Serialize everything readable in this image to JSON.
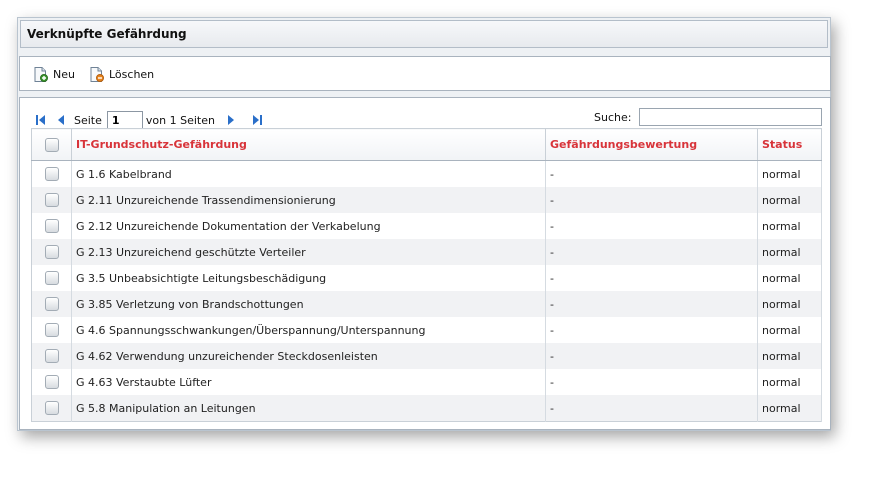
{
  "window": {
    "title": "Verknüpfte Gefährdung"
  },
  "toolbar": {
    "new_label": "Neu",
    "new_icon": "document-add-icon",
    "delete_label": "Löschen",
    "delete_icon": "document-delete-icon"
  },
  "pager": {
    "page_label": "Seite",
    "current_page": "1",
    "of_pages": "von 1 Seiten",
    "icons": [
      "first-page-icon",
      "previous-page-icon",
      "next-page-icon",
      "last-page-icon"
    ]
  },
  "search": {
    "label": "Suche:",
    "value": ""
  },
  "colors": {
    "header_text": "#d8343a",
    "accent_blue": "#2a6fc9"
  },
  "table": {
    "columns": [
      "IT-Grundschutz-Gefährdung",
      "Gefährdungsbewertung",
      "Status"
    ],
    "rows": [
      {
        "name": "G 1.6 Kabelbrand",
        "rating": "-",
        "status": "normal"
      },
      {
        "name": "G 2.11 Unzureichende Trassendimensionierung",
        "rating": "-",
        "status": "normal"
      },
      {
        "name": "G 2.12 Unzureichende Dokumentation der Verkabelung",
        "rating": "-",
        "status": "normal"
      },
      {
        "name": "G 2.13 Unzureichend geschützte Verteiler",
        "rating": "-",
        "status": "normal"
      },
      {
        "name": "G 3.5 Unbeabsichtigte Leitungsbeschädigung",
        "rating": "-",
        "status": "normal"
      },
      {
        "name": "G 3.85 Verletzung von Brandschottungen",
        "rating": "-",
        "status": "normal"
      },
      {
        "name": "G 4.6 Spannungsschwankungen/Überspannung/Unterspannung",
        "rating": "-",
        "status": "normal"
      },
      {
        "name": "G 4.62 Verwendung unzureichender Steckdosenleisten",
        "rating": "-",
        "status": "normal"
      },
      {
        "name": "G 4.63 Verstaubte Lüfter",
        "rating": "-",
        "status": "normal"
      },
      {
        "name": "G 5.8 Manipulation an Leitungen",
        "rating": "-",
        "status": "normal"
      }
    ]
  }
}
